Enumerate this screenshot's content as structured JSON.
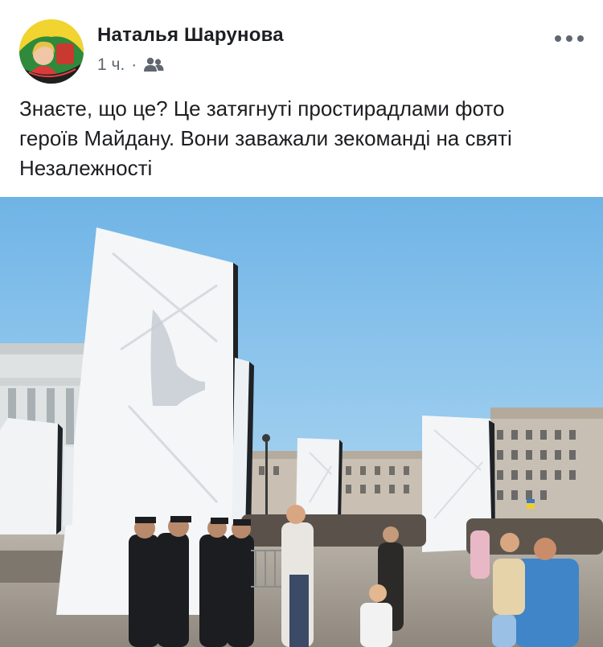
{
  "post": {
    "author": "Наталья Шарунова",
    "time": "1 ч.",
    "separator": "·",
    "audience_icon": "friends-icon",
    "text_lines": [
      "Знаєте,  що це?  Це затягнуті простирадлами фото",
      "героїв Майдану.  Вони заважали зекоманді на святі",
      "Незалежності"
    ]
  },
  "avatar_badge_text": "Наталья Шарунова",
  "photo": {
    "description_icon": "post-photo",
    "sky_color": "#7fbde8",
    "banner_color": "#f4f6f8"
  }
}
